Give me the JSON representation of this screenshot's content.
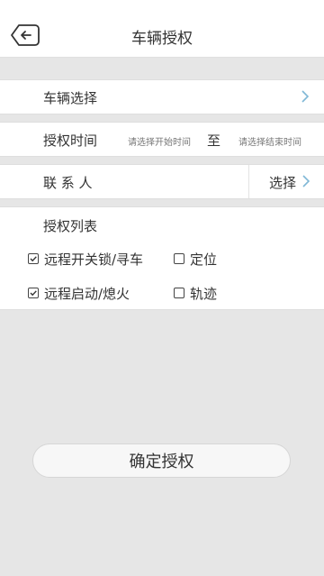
{
  "header": {
    "title": "车辆授权"
  },
  "vehicle_row": {
    "label": "车辆选择"
  },
  "time_row": {
    "label": "授权时间",
    "start_placeholder": "请选择开始时间",
    "to": "至",
    "end_placeholder": "请选择结束时间"
  },
  "contact_row": {
    "label": "联 系 人",
    "choose": "选择"
  },
  "permissions": {
    "label": "授权列表",
    "items": [
      {
        "label": "远程开关锁/寻车",
        "checked": true
      },
      {
        "label": "定位",
        "checked": false
      },
      {
        "label": "远程启动/熄火",
        "checked": true
      },
      {
        "label": "轨迹",
        "checked": false
      }
    ]
  },
  "confirm_label": "确定授权",
  "colors": {
    "background": "#e6e6e6",
    "chevron": "#7fb7d6"
  }
}
